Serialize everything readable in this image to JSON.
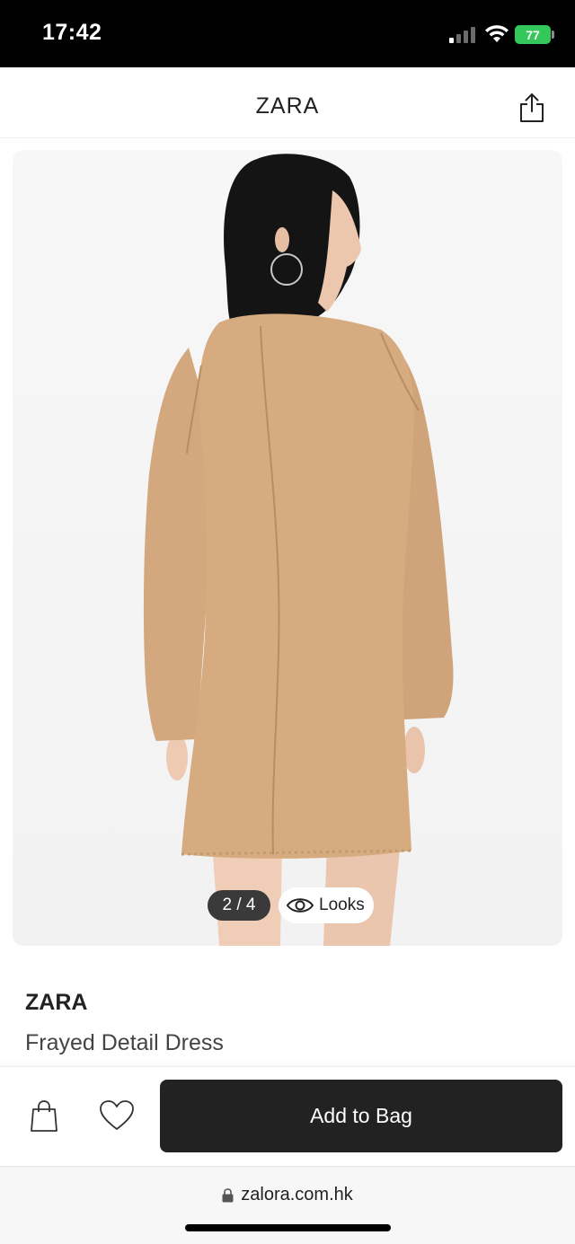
{
  "status_bar": {
    "time": "17:42",
    "battery": "77",
    "icons": [
      "signal-icon",
      "wifi-icon",
      "battery-icon"
    ]
  },
  "header": {
    "title": "ZARA",
    "share_icon": "share-icon"
  },
  "gallery": {
    "counter": "2 / 4",
    "looks_label": "Looks",
    "looks_icon": "eye-icon"
  },
  "product": {
    "brand": "ZARA",
    "name": "Frayed Detail Dress"
  },
  "actions": {
    "bag_icon": "shopping-bag-icon",
    "wishlist_icon": "heart-icon",
    "add_to_bag_label": "Add to Bag"
  },
  "browser": {
    "url": "zalora.com.hk",
    "lock_icon": "lock-icon"
  },
  "colors": {
    "accent": "#222222",
    "battery": "#34c759",
    "dress": "#d4a77d"
  }
}
